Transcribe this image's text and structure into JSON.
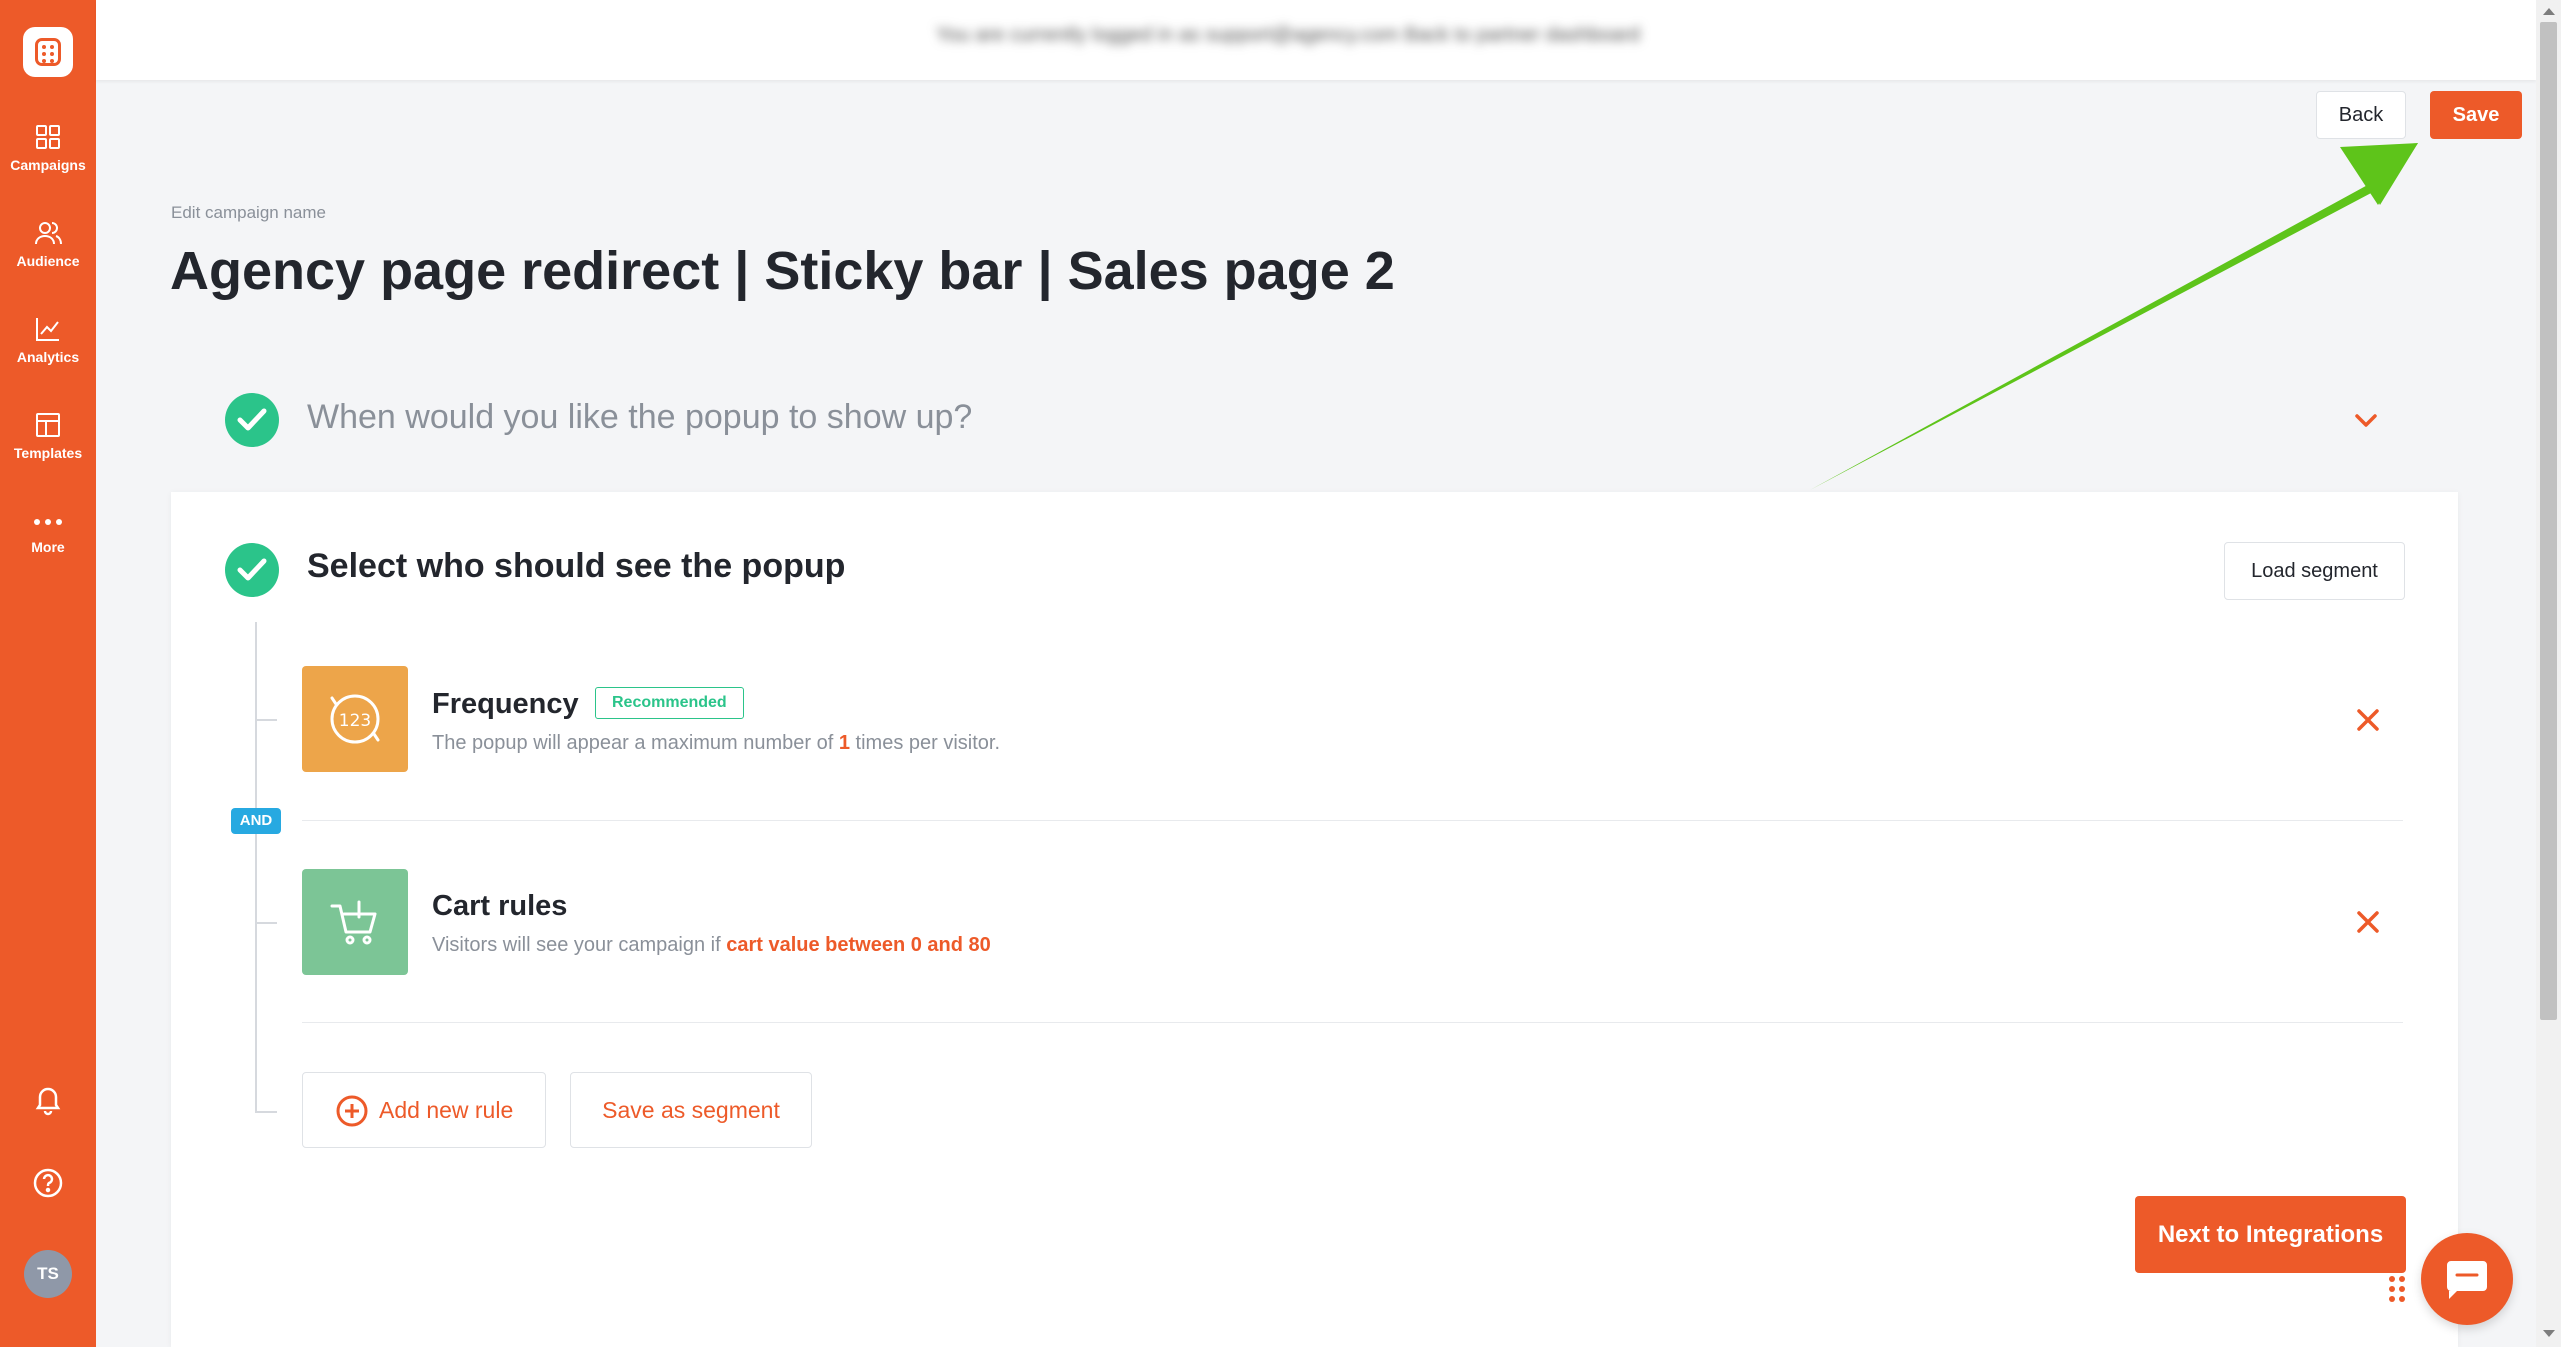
{
  "sidebar": {
    "items": [
      {
        "label": "Campaigns",
        "icon": "grid-icon"
      },
      {
        "label": "Audience",
        "icon": "users-icon"
      },
      {
        "label": "Analytics",
        "icon": "chart-icon"
      },
      {
        "label": "Templates",
        "icon": "layout-icon"
      },
      {
        "label": "More",
        "icon": "more-dots-icon"
      }
    ],
    "bottom_icons": [
      "bell-icon",
      "help-icon"
    ],
    "avatar_initials": "TS"
  },
  "header": {
    "notice": "You are currently logged in as support@agency.com  Back to partner dashboard",
    "back_label": "Back",
    "save_label": "Save"
  },
  "campaign": {
    "edit_label": "Edit campaign name",
    "title": "Agency page redirect | Sticky bar | Sales page 2"
  },
  "steps": {
    "step1_title": "When would you like the popup to show up?",
    "step2_title": "Select who should see the popup",
    "load_segment_label": "Load segment"
  },
  "rules": [
    {
      "title": "Frequency",
      "badge": "Recommended",
      "desc_prefix": "The popup will appear a maximum number of ",
      "desc_highlight": "1",
      "desc_suffix": " times per visitor.",
      "icon": "frequency-icon",
      "icon_text": "123",
      "color": "#eda54a"
    },
    {
      "title": "Cart rules",
      "desc_prefix": "Visitors will see your campaign if ",
      "desc_highlight": "cart value between 0 and 80",
      "icon": "cart-icon",
      "color": "#7cc596"
    }
  ],
  "connector_label": "AND",
  "actions": {
    "add_rule_label": "Add new rule",
    "save_segment_label": "Save as segment",
    "next_label": "Next to Integrations"
  },
  "colors": {
    "accent": "#ed5a29",
    "success": "#2bc48a",
    "info": "#27a9e1",
    "arrow": "#5ec41a"
  }
}
